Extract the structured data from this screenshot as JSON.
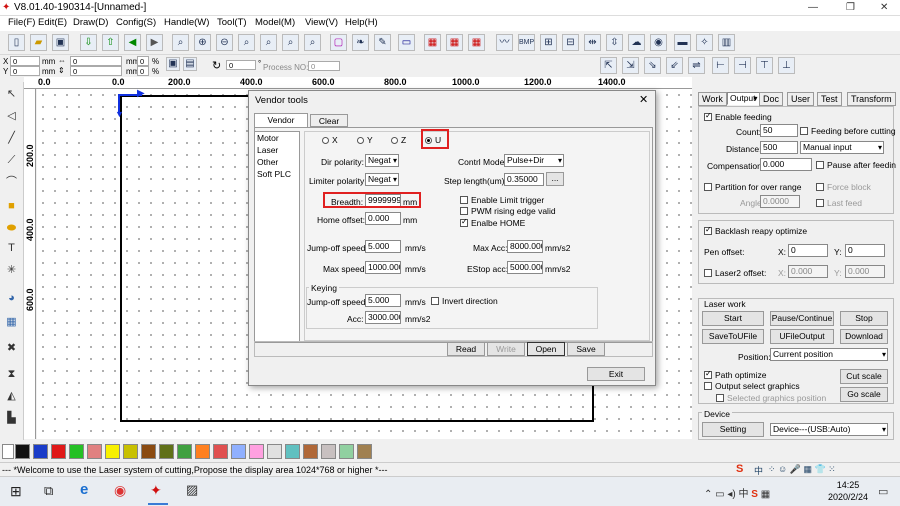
{
  "window": {
    "title": "V8.01.40-190314-[Unnamed-]",
    "min": "—",
    "max": "❐",
    "close": "✕"
  },
  "menu": [
    "File(F)",
    "Edit(E)",
    "Draw(D)",
    "Config(S)",
    "Handle(W)",
    "Tool(T)",
    "Model(M)",
    "View(V)",
    "Help(H)"
  ],
  "coords": {
    "x_label": "X",
    "y_label": "Y",
    "x_val": "0",
    "y_val": "0",
    "unit": "mm",
    "w_val": "0",
    "h_val": "0",
    "w_unit": "mm",
    "h_unit": "mm",
    "px_val": "0",
    "py_val": "0",
    "pct": "%",
    "angle": "0",
    "deg": "°",
    "process_label": "Process NO:",
    "process_val": "0"
  },
  "ruler": {
    "h": [
      "0.0",
      "200.0",
      "400.0",
      "600.0",
      "800.0",
      "1000.0",
      "1200.0",
      "1400.0"
    ],
    "v": [
      "200.0",
      "400.0",
      "600.0"
    ]
  },
  "palette": [
    "#111111",
    "#1a3cc8",
    "#e01818",
    "#25c025",
    "#f0f000",
    "#e08080",
    "#f8f000",
    "#8a4a10",
    "#607018",
    "#40a040",
    "#ff8020",
    "#90b0ff",
    "#ffa0e0",
    "#e0e0e0",
    "#60c0c0",
    "#b06838",
    "#c8c0c0",
    "#90d0a0",
    "#a08050"
  ],
  "status": "--- *Welcome to use the Laser system of cutting,Propose the display area 1024*768 or higher *---",
  "rpanel": {
    "tabs": [
      "Work",
      "Output",
      "Doc",
      "User",
      "Test",
      "Transform"
    ],
    "enable_feeding": "Enable feeding",
    "count_label": "Count:",
    "count_val": "50",
    "feed_before": "Feeding before cutting",
    "distance_label": "Distance:",
    "distance_val": "500",
    "feed_mode": "Manual input",
    "comp_label": "Compensation:",
    "comp_val": "0.000",
    "pause_after": "Pause after feedin",
    "partition": "Partition for over range",
    "force_block": "Force block",
    "angle_label": "Angle",
    "angle_val": "0.0000",
    "last_feed": "Last feed",
    "backlash": "Backlash reapy optimize",
    "pen_offset": "Pen offset:",
    "pen_x_label": "X:",
    "pen_x": "0",
    "pen_y_label": "Y:",
    "pen_y": "0",
    "laser2": "Laser2 offset:",
    "l2_x_label": "X:",
    "l2_x": "0.000",
    "l2_y_label": "Y:",
    "l2_y": "0.000",
    "laser_work": "Laser work",
    "start": "Start",
    "pause": "Pause/Continue",
    "stop": "Stop",
    "save_u": "SaveToUFile",
    "ufile_out": "UFileOutput",
    "download": "Download",
    "position_label": "Position:",
    "position_val": "Current position",
    "path_opt": "Path optimize",
    "output_sel": "Output select graphics",
    "cut_scale": "Cut scale",
    "sel_pos": "Selected graphics position",
    "go_scale": "Go scale",
    "device": "Device",
    "setting": "Setting",
    "device_val": "Device---(USB:Auto)"
  },
  "dialog": {
    "title": "Vendor tools",
    "close": "✕",
    "tabs": [
      "Vendor param",
      "Clear info"
    ],
    "list": [
      "Motor",
      "Laser",
      "Other",
      "Soft PLC"
    ],
    "axes": [
      "X",
      "Y",
      "Z",
      "U"
    ],
    "dir_pol_label": "Dir polarity:",
    "dir_pol": "Negat",
    "ctrl_mode_label": "Contrl Mode:",
    "ctrl_mode": "Pulse+Dir",
    "lim_pol_label": "Limiter polarity:",
    "lim_pol": "Negat",
    "step_len_label": "Step length(um):",
    "step_len": "0.35000",
    "dots": "...",
    "breadth_label": "Breadth:",
    "breadth": "99999999",
    "mm": "mm",
    "enable_limit": "Enable Limit trigger",
    "pwm": "PWM rising edge valid",
    "home_off_label": "Home offset:",
    "home_off": "0.000",
    "enable_home": "Enalbe HOME",
    "jump_label": "Jump-off speed:",
    "jump": "5.000",
    "mms": "mm/s",
    "max_acc_label": "Max Acc:",
    "max_acc": "8000.000",
    "mms2": "mm/s2",
    "max_speed_label": "Max speed:",
    "max_speed": "1000.000",
    "estop_label": "EStop acc:",
    "estop": "5000.000",
    "keying": "Keying",
    "k_jump_label": "Jump-off speed:",
    "k_jump": "5.000",
    "invert": "Invert direction",
    "acc_label": "Acc:",
    "acc": "3000.000",
    "read": "Read",
    "write": "Write",
    "open": "Open",
    "save": "Save",
    "exit": "Exit"
  },
  "taskbar": {
    "time": "14:25",
    "date": "2020/2/24",
    "lang": "中",
    "ime": "S"
  }
}
